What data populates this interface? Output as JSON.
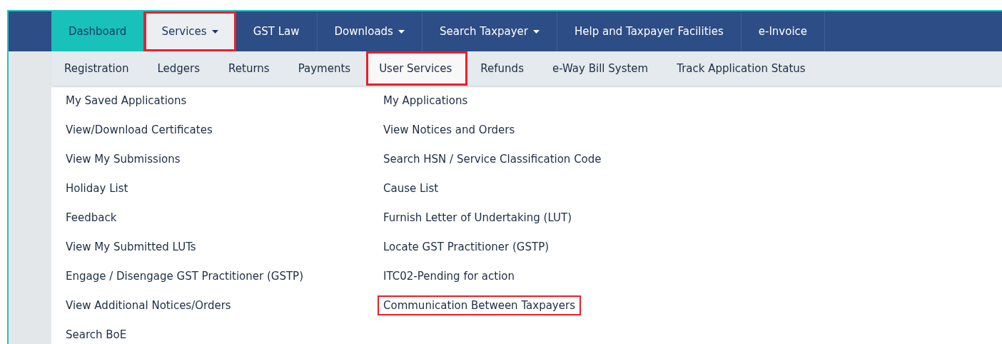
{
  "main_nav": [
    {
      "label": "Dashboard",
      "current": true,
      "open": false,
      "has_dropdown": false,
      "highlighted": false
    },
    {
      "label": "Services",
      "current": false,
      "open": true,
      "has_dropdown": true,
      "highlighted": true
    },
    {
      "label": "GST Law",
      "current": false,
      "open": false,
      "has_dropdown": false,
      "highlighted": false
    },
    {
      "label": "Downloads",
      "current": false,
      "open": false,
      "has_dropdown": true,
      "highlighted": false
    },
    {
      "label": "Search Taxpayer",
      "current": false,
      "open": false,
      "has_dropdown": true,
      "highlighted": false
    },
    {
      "label": "Help and Taxpayer Facilities",
      "current": false,
      "open": false,
      "has_dropdown": false,
      "highlighted": false
    },
    {
      "label": "e-Invoice",
      "current": false,
      "open": false,
      "has_dropdown": false,
      "highlighted": false
    }
  ],
  "sub_nav": [
    {
      "label": "Registration",
      "selected": false,
      "highlighted": false
    },
    {
      "label": "Ledgers",
      "selected": false,
      "highlighted": false
    },
    {
      "label": "Returns",
      "selected": false,
      "highlighted": false
    },
    {
      "label": "Payments",
      "selected": false,
      "highlighted": false
    },
    {
      "label": "User Services",
      "selected": true,
      "highlighted": true
    },
    {
      "label": "Refunds",
      "selected": false,
      "highlighted": false
    },
    {
      "label": "e-Way Bill System",
      "selected": false,
      "highlighted": false
    },
    {
      "label": "Track Application Status",
      "selected": false,
      "highlighted": false
    }
  ],
  "menu_columns": [
    [
      {
        "label": "My Saved Applications",
        "highlighted": false
      },
      {
        "label": "View/Download Certificates",
        "highlighted": false
      },
      {
        "label": "View My Submissions",
        "highlighted": false
      },
      {
        "label": "Holiday List",
        "highlighted": false
      },
      {
        "label": "Feedback",
        "highlighted": false
      },
      {
        "label": "View My Submitted LUTs",
        "highlighted": false
      },
      {
        "label": "Engage / Disengage GST Practitioner (GSTP)",
        "highlighted": false
      },
      {
        "label": "View Additional Notices/Orders",
        "highlighted": false
      },
      {
        "label": "Search BoE",
        "highlighted": false
      }
    ],
    [
      {
        "label": "My Applications",
        "highlighted": false
      },
      {
        "label": "View Notices and Orders",
        "highlighted": false
      },
      {
        "label": "Search HSN / Service Classification Code",
        "highlighted": false
      },
      {
        "label": "Cause List",
        "highlighted": false
      },
      {
        "label": "Furnish Letter of Undertaking (LUT)",
        "highlighted": false
      },
      {
        "label": "Locate GST Practitioner (GSTP)",
        "highlighted": false
      },
      {
        "label": "ITC02-Pending for action",
        "highlighted": false
      },
      {
        "label": "Communication Between Taxpayers",
        "highlighted": true
      }
    ]
  ]
}
